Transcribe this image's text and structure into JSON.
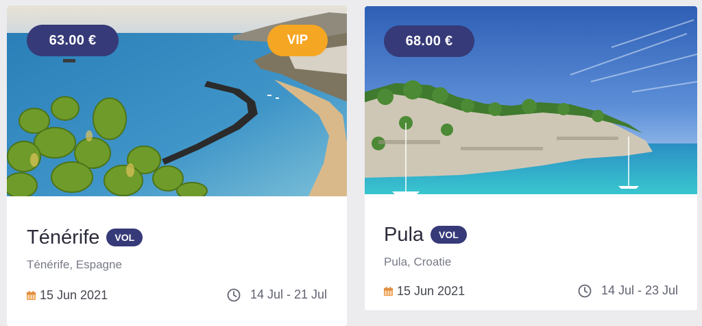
{
  "cards": [
    {
      "price": "63.00 €",
      "vip_badge": "VIP",
      "title": "Ténérife",
      "type_badge": "VOL",
      "location": "Ténérife, Espagne",
      "departure_date": "15 Jun 2021",
      "stay_range": "14 Jul - 21 Jul",
      "image_subject": "Las Teresitas beach with cactus and sea"
    },
    {
      "price": "68.00 €",
      "title": "Pula",
      "type_badge": "VOL",
      "location": "Pula, Croatie",
      "departure_date": "15 Jun 2021",
      "stay_range": "14 Jul - 23 Jul",
      "image_subject": "Rocky cliffs over turquoise bay"
    }
  ],
  "colors": {
    "badge_navy": "#363a78",
    "vip_orange": "#f5a623",
    "calendar_orange": "#f0a55a"
  },
  "icons": {
    "date": "calendar-icon",
    "duration": "clock-icon"
  }
}
